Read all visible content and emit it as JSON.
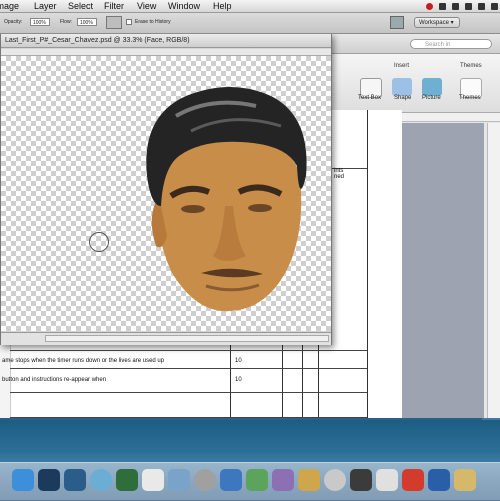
{
  "menubar": {
    "items": [
      "Image",
      "Layer",
      "Select",
      "Filter",
      "View",
      "Window",
      "Help"
    ]
  },
  "options_bar": {
    "opacity_label": "Opacity:",
    "opacity_value": "100%",
    "flow_label": "Flow:",
    "flow_value": "100%",
    "erase_to_history": "Erase to History",
    "workspace": "Workspace"
  },
  "ps_window": {
    "title": "Last_First_P#_Cesar_Chavez.psd @ 33.3% (Face, RGB/8)"
  },
  "word": {
    "search_placeholder": "Search in",
    "ribbon_groups": [
      "Insert",
      "Themes"
    ],
    "tools": [
      "Text Box",
      "Shape",
      "Picture",
      "Themes"
    ],
    "table_header_lines": [
      "ints",
      "ned"
    ],
    "rows": [
      {
        "text": "ame stops when the timer runs down or the lives are used up",
        "points": "10"
      },
      {
        "text": "button and instructions re-appear when",
        "points": "10"
      }
    ]
  },
  "colors": {
    "accent": "#2a5f86",
    "skin": "#c58a48",
    "hair": "#232323"
  }
}
